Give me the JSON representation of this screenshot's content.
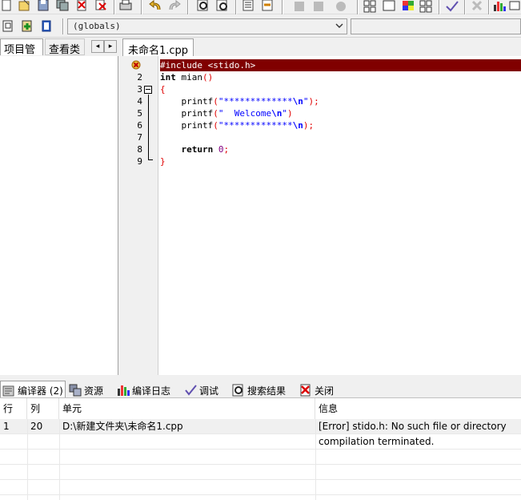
{
  "toolbar": {
    "globals_value": "(globals)"
  },
  "left_panel": {
    "tabs": [
      "项目管理",
      "查看类"
    ],
    "nav_prev": "◂",
    "nav_next": "▸"
  },
  "editor": {
    "tab_label": "未命名1.cpp",
    "line_numbers": [
      "2",
      "3",
      "4",
      "5",
      "6",
      "7",
      "8",
      "9"
    ],
    "lines": [
      {
        "parts": [
          {
            "t": "#include <stido.h>",
            "c": ""
          }
        ],
        "error": true
      },
      {
        "parts": [
          {
            "t": "int",
            "c": "kw"
          },
          {
            "t": " mian",
            "c": ""
          },
          {
            "t": "()",
            "c": "br"
          }
        ]
      },
      {
        "parts": [
          {
            "t": "{",
            "c": "br"
          }
        ]
      },
      {
        "parts": [
          {
            "t": "    printf",
            "c": ""
          },
          {
            "t": "(",
            "c": "br"
          },
          {
            "t": "\"*************",
            "c": "str"
          },
          {
            "t": "\\n",
            "c": "kw str"
          },
          {
            "t": "\"",
            "c": "str"
          },
          {
            "t": ");",
            "c": "br"
          }
        ]
      },
      {
        "parts": [
          {
            "t": "    printf",
            "c": ""
          },
          {
            "t": "(",
            "c": "br"
          },
          {
            "t": "\"  Welcome",
            "c": "str"
          },
          {
            "t": "\\n",
            "c": "kw str"
          },
          {
            "t": "\"",
            "c": "str"
          },
          {
            "t": ")",
            "c": "br"
          }
        ]
      },
      {
        "parts": [
          {
            "t": "    printf",
            "c": ""
          },
          {
            "t": "(",
            "c": "br"
          },
          {
            "t": "\"*************",
            "c": "str"
          },
          {
            "t": "\\n",
            "c": "kw str"
          },
          {
            "t": ");",
            "c": "br"
          }
        ]
      },
      {
        "parts": [
          {
            "t": "",
            "c": ""
          }
        ]
      },
      {
        "parts": [
          {
            "t": "    return ",
            "c": "kw"
          },
          {
            "t": "0",
            "c": "num"
          },
          {
            "t": ";",
            "c": "br"
          }
        ]
      },
      {
        "parts": [
          {
            "t": "}",
            "c": "br"
          }
        ]
      }
    ]
  },
  "bottom_tabs": [
    {
      "label": "编译器 (2)",
      "icon": "compiler-icon"
    },
    {
      "label": "资源",
      "icon": "resources-icon"
    },
    {
      "label": "编译日志",
      "icon": "compile-log-icon"
    },
    {
      "label": "调试",
      "icon": "debug-check-icon"
    },
    {
      "label": "搜索结果",
      "icon": "search-results-icon"
    },
    {
      "label": "关闭",
      "icon": "close-icon"
    }
  ],
  "results": {
    "columns": [
      "行",
      "列",
      "单元",
      "信息"
    ],
    "rows": [
      {
        "line": "1",
        "col": "20",
        "unit": "D:\\新建文件夹\\未命名1.cpp",
        "msg": "[Error] stido.h: No such file or directory"
      },
      {
        "line": "",
        "col": "",
        "unit": "",
        "msg": "compilation terminated."
      }
    ]
  },
  "colors": {
    "error_line_bg": "#800000",
    "bracket": "#e00000",
    "string": "#0000ff",
    "number": "#800080"
  }
}
